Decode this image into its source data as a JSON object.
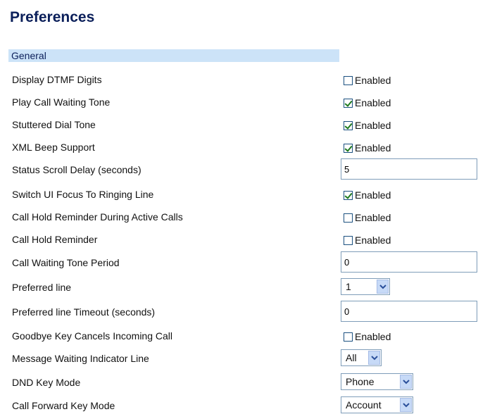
{
  "page": {
    "title": "Preferences"
  },
  "section": {
    "label": "General"
  },
  "colors": {
    "title": "#0b1f5a",
    "section_bg": "#cce3f8",
    "check": "#1e7a1e"
  },
  "rows": [
    {
      "label": "Display DTMF Digits",
      "type": "checkbox",
      "checked": false,
      "checkbox_label": "Enabled"
    },
    {
      "label": "Play Call Waiting Tone",
      "type": "checkbox",
      "checked": true,
      "checkbox_label": "Enabled"
    },
    {
      "label": "Stuttered Dial Tone",
      "type": "checkbox",
      "checked": true,
      "checkbox_label": "Enabled"
    },
    {
      "label": "XML Beep Support",
      "type": "checkbox",
      "checked": true,
      "checkbox_label": "Enabled"
    },
    {
      "label": "Status Scroll Delay (seconds)",
      "type": "text",
      "value": "5"
    },
    {
      "label": "Switch UI Focus To Ringing Line",
      "type": "checkbox",
      "checked": true,
      "checkbox_label": "Enabled"
    },
    {
      "label": "Call Hold Reminder During Active Calls",
      "type": "checkbox",
      "checked": false,
      "checkbox_label": "Enabled"
    },
    {
      "label": "Call Hold Reminder",
      "type": "checkbox",
      "checked": false,
      "checkbox_label": "Enabled"
    },
    {
      "label": "Call Waiting Tone Period",
      "type": "text",
      "value": "0"
    },
    {
      "label": "Preferred line",
      "type": "select",
      "value": "1"
    },
    {
      "label": "Preferred line Timeout (seconds)",
      "type": "text",
      "value": "0"
    },
    {
      "label": "Goodbye Key Cancels Incoming Call",
      "type": "checkbox",
      "checked": false,
      "checkbox_label": "Enabled"
    },
    {
      "label": "Message Waiting Indicator Line",
      "type": "select",
      "value": "All"
    },
    {
      "label": "DND Key Mode",
      "type": "select",
      "value": "Phone"
    },
    {
      "label": "Call Forward Key Mode",
      "type": "select",
      "value": "Account"
    }
  ]
}
